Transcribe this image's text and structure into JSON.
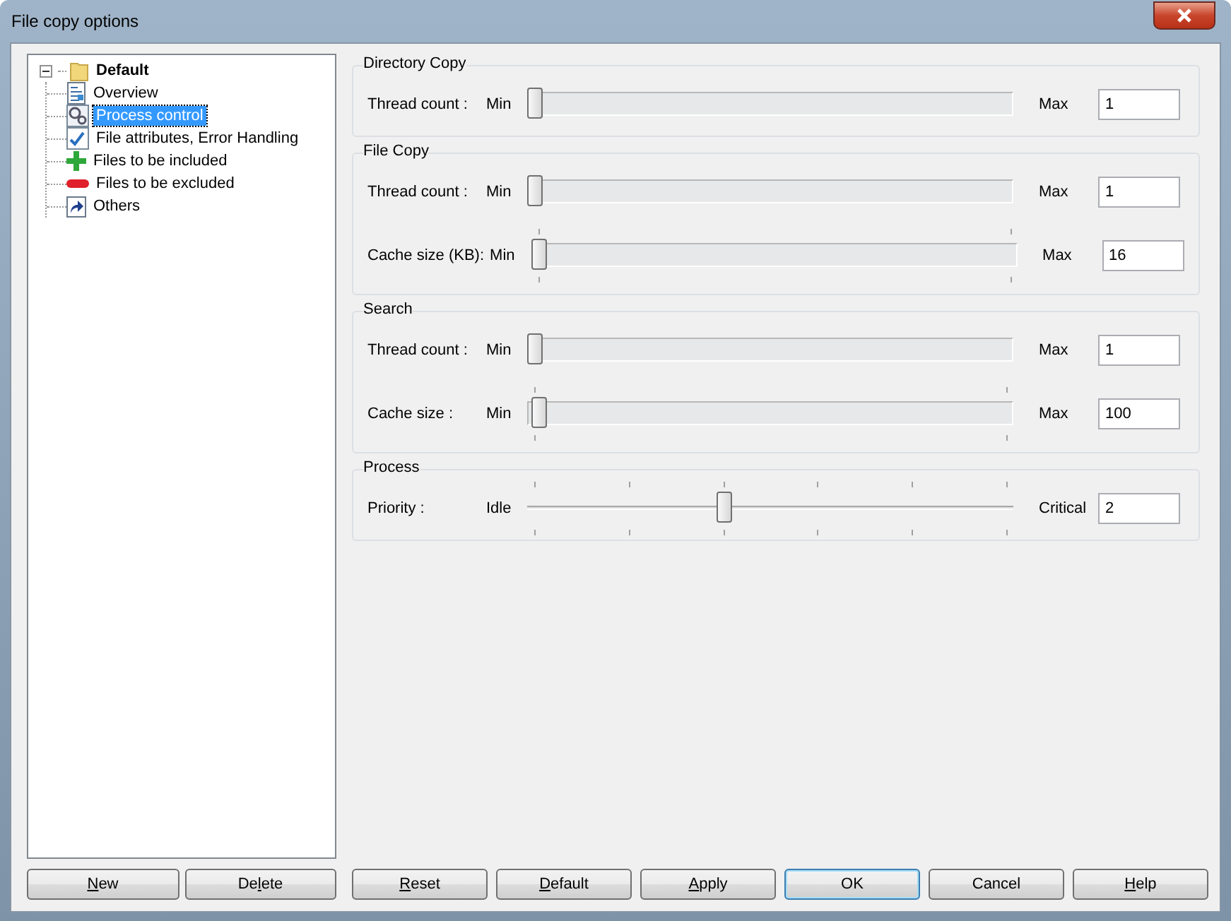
{
  "window": {
    "title": "File copy options"
  },
  "tree": {
    "label": "Default",
    "expanded": true,
    "selected": false,
    "children": [
      {
        "label": "Overview",
        "kind": "document",
        "selected": false
      },
      {
        "label": "Process control",
        "kind": "settings",
        "selected": true
      },
      {
        "label": "File attributes, Error Handling",
        "kind": "attributes",
        "selected": false
      },
      {
        "label": "Files to be included",
        "kind": "include",
        "selected": false
      },
      {
        "label": "Files to be excluded",
        "kind": "exclude",
        "selected": false
      },
      {
        "label": "Others",
        "kind": "shortcut",
        "selected": false
      }
    ]
  },
  "groups": [
    {
      "title": "Directory Copy",
      "rows": [
        {
          "label": "Thread count :",
          "min": "Min",
          "max": "Max",
          "value": "1",
          "kind": "plain",
          "level": 0
        }
      ]
    },
    {
      "title": "File Copy",
      "rows": [
        {
          "label": "Thread count :",
          "min": "Min",
          "max": "Max",
          "value": "1",
          "kind": "plain",
          "level": 0
        },
        {
          "label": "Cache size (KB):",
          "min": "Min",
          "max": "Max",
          "value": "16",
          "kind": "ticked",
          "level": 0
        }
      ]
    },
    {
      "title": "Search",
      "rows": [
        {
          "label": "Thread count :",
          "min": "Min",
          "max": "Max",
          "value": "1",
          "kind": "plain",
          "level": 0
        },
        {
          "label": "Cache size :",
          "min": "Min",
          "max": "Max",
          "value": "100",
          "kind": "ticked",
          "level": 0.01
        }
      ]
    },
    {
      "title": "Process",
      "rows": [
        {
          "label": "Priority :",
          "min": "Idle",
          "max": "Critical",
          "value": "2",
          "kind": "scale",
          "level": 0.4
        }
      ]
    }
  ],
  "left_buttons": [
    {
      "key": "N",
      "after": "ew",
      "default": false
    },
    {
      "before": "De",
      "key": "l",
      "after": "ete",
      "default": false
    }
  ],
  "right_buttons": [
    {
      "key": "R",
      "after": "eset",
      "default": false
    },
    {
      "key": "D",
      "after": "efault",
      "default": false
    },
    {
      "key": "A",
      "after": "pply",
      "default": false
    },
    {
      "before": "OK",
      "default": true
    },
    {
      "before": "Cancel",
      "default": false
    },
    {
      "key": "H",
      "after": "elp",
      "default": false
    }
  ]
}
